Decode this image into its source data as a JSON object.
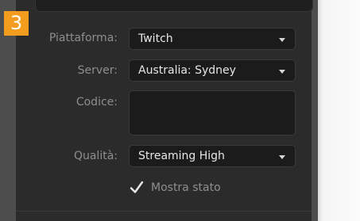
{
  "step": "3",
  "form": {
    "platform": {
      "label": "Piattaforma:",
      "value": "Twitch"
    },
    "server": {
      "label": "Server:",
      "value": "Australia: Sydney"
    },
    "key": {
      "label": "Codice:",
      "value": ""
    },
    "quality": {
      "label": "Qualità:",
      "value": "Streaming High"
    },
    "show_status": {
      "label": "Mostra stato",
      "checked": true
    }
  },
  "colors": {
    "badge": "#f39c1e",
    "panel": "#2b2b2b",
    "field": "#1b1b1b",
    "label_text": "#8e8e8e",
    "value_text": "#e6e6e6"
  },
  "icons": [
    "dropdown-caret-icon",
    "checkmark-icon"
  ]
}
